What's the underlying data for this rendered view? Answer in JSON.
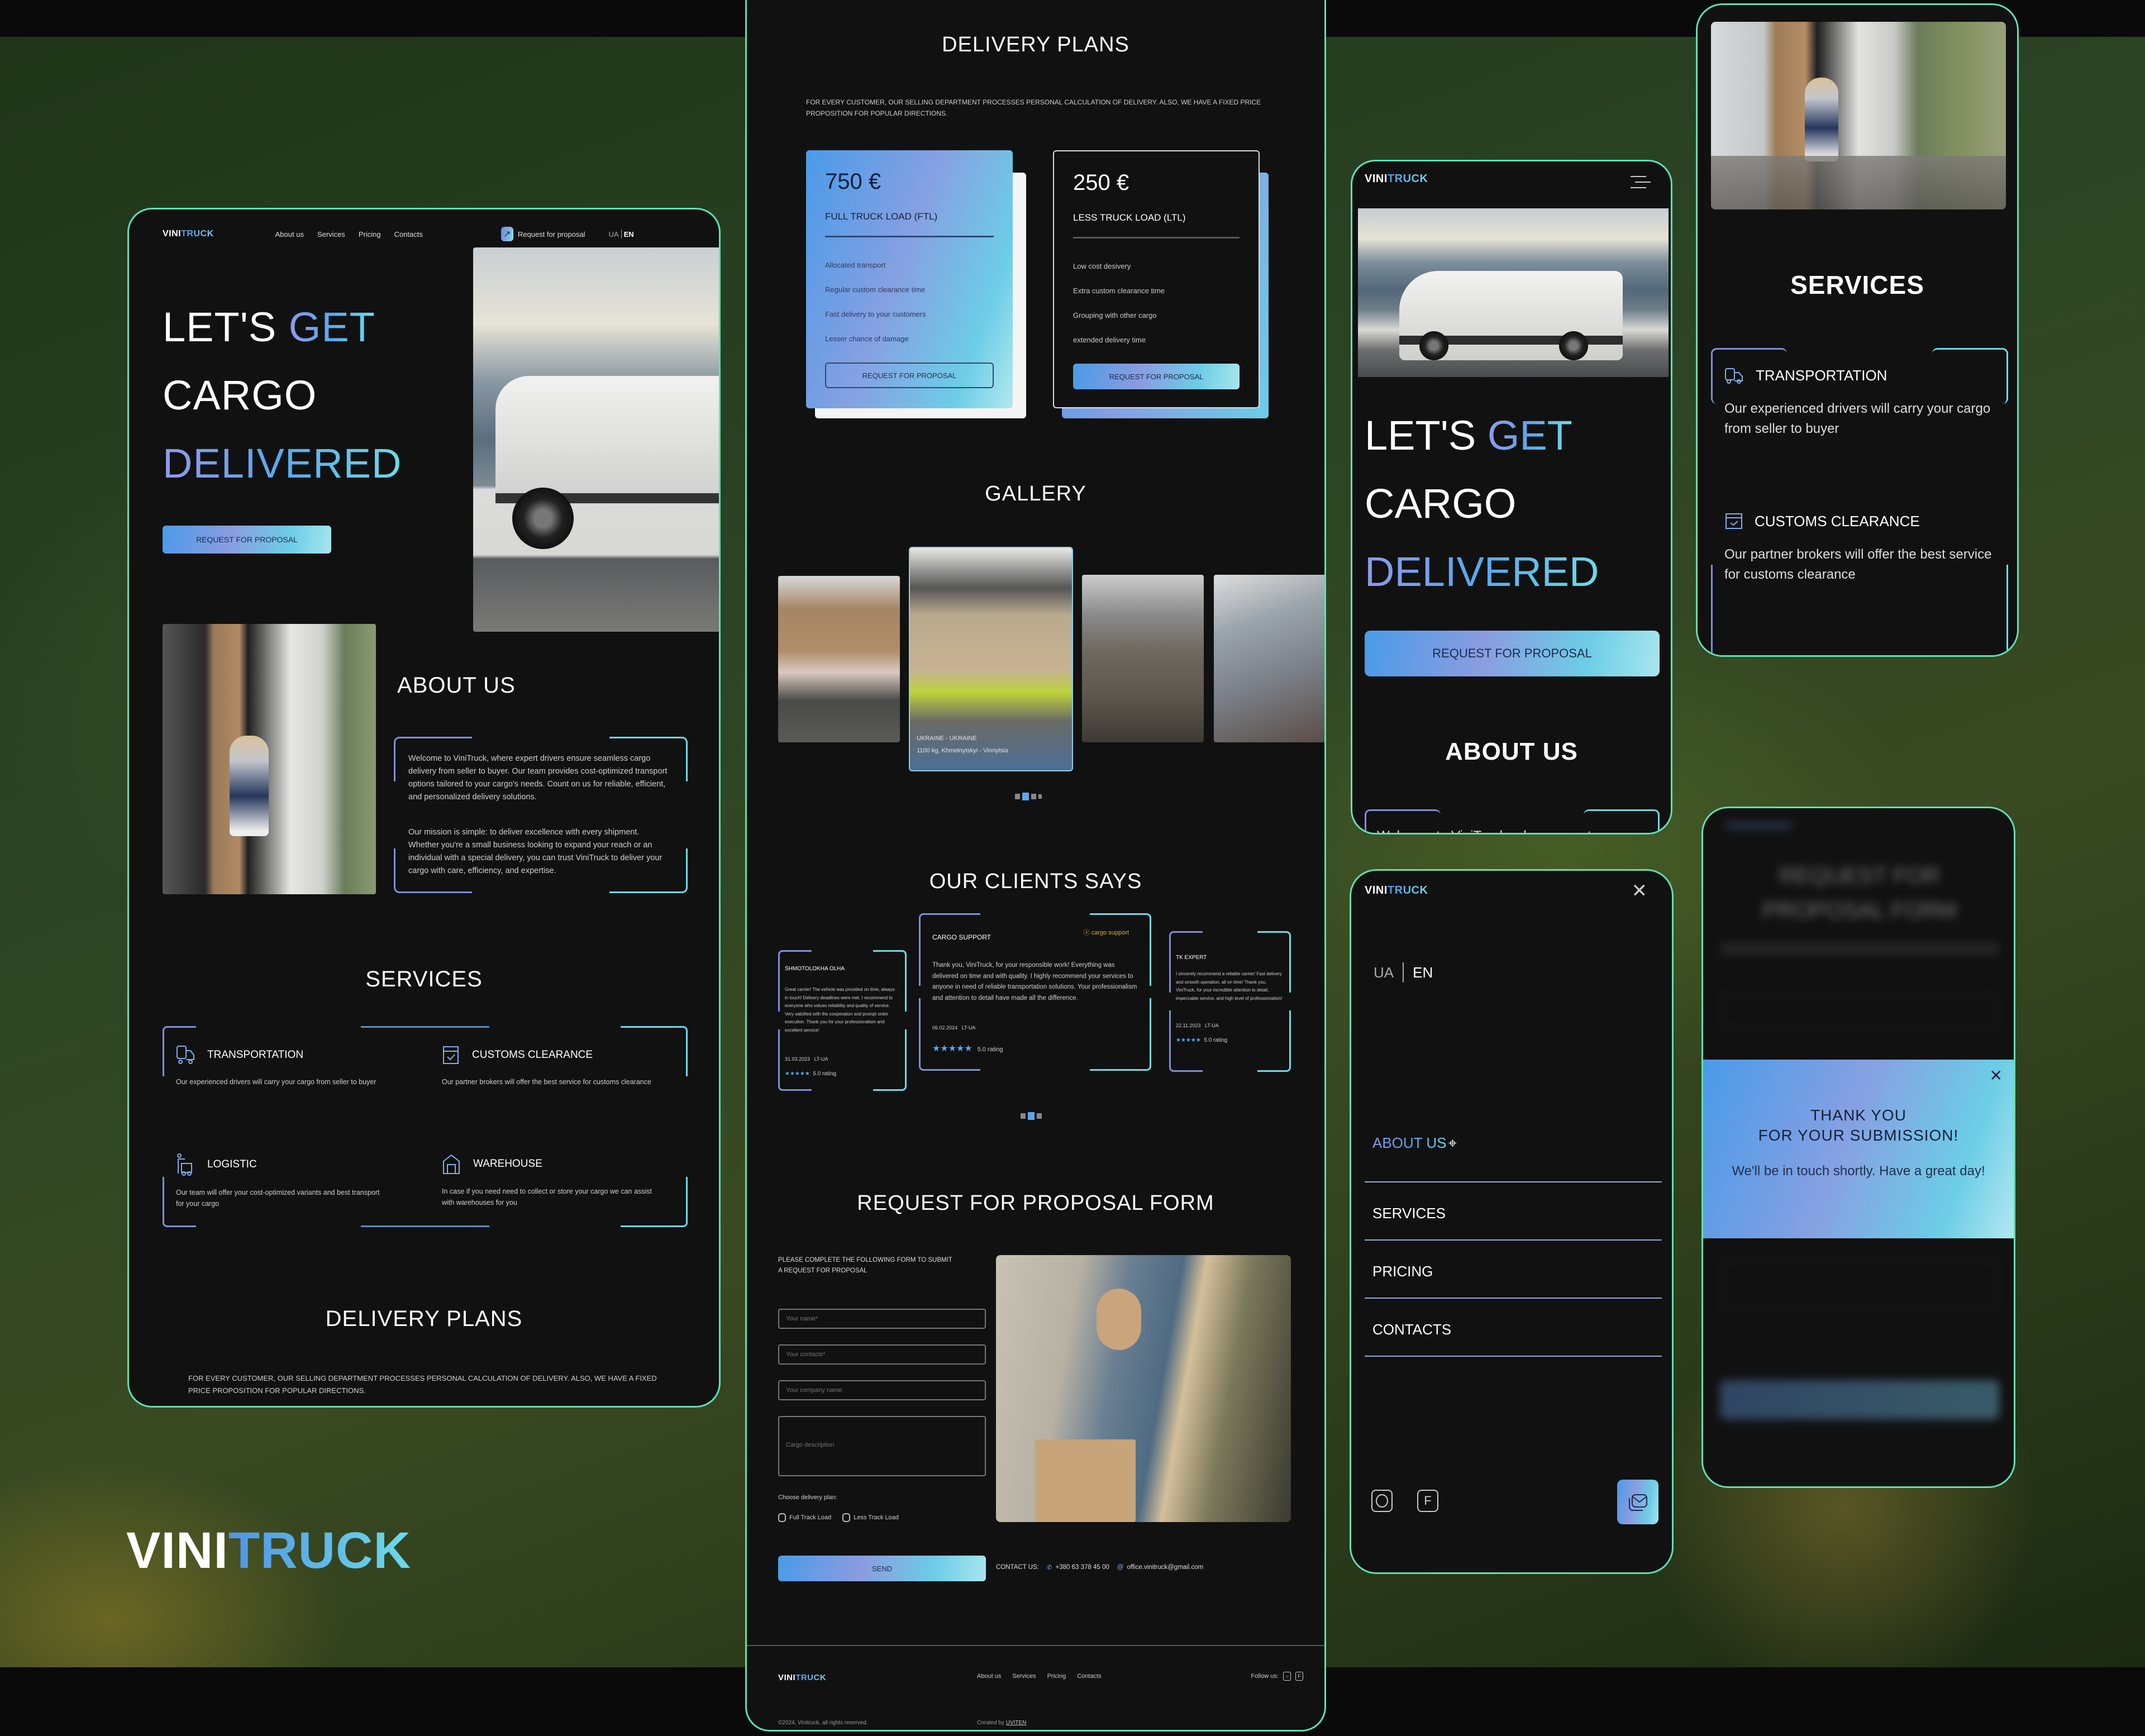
{
  "brand": {
    "logo_a": "VINI",
    "logo_b": "TRUCK"
  },
  "desktop": {
    "nav": [
      "About us",
      "Services",
      "Pricing",
      "Contacts"
    ],
    "request_link": "Request for proposal",
    "lang": {
      "ua": "UA",
      "en": "EN"
    },
    "hero": {
      "line1a": "LET'S ",
      "line1b": "GET",
      "line2": "CARGO",
      "line3": "DELIVERED",
      "button": "REQUEST FOR PROPOSAL"
    },
    "about": {
      "title": "ABOUT US",
      "p1": "Welcome to ViniTruck, where expert drivers ensure seamless cargo delivery from seller to buyer. Our team provides cost-optimized transport options tailored to your cargo's needs. Count on us for reliable, efficient, and personalized delivery solutions.",
      "p2": "Our mission is simple: to deliver excellence with every shipment. Whether you're a small business looking to expand your reach or an individual with a special delivery, you can trust ViniTruck to deliver your cargo with care, efficiency, and expertise."
    },
    "services": {
      "title": "SERVICES",
      "items": [
        {
          "icon": "truck-icon",
          "title": "TRANSPORTATION",
          "text": "Our experienced drivers will carry your cargo from seller to buyer"
        },
        {
          "icon": "customs-box-icon",
          "title": "CUSTOMS CLEARANCE",
          "text": "Our partner brokers will offer the best service for customs clearance"
        },
        {
          "icon": "logistic-icon",
          "title": "LOGISTIC",
          "text": "Our team will offer your cost-optimized variants and best transport for your cargo"
        },
        {
          "icon": "warehouse-icon",
          "title": "WAREHOUSE",
          "text": "In case if you need need to collect or store your cargo we can assist with warehouses for you"
        }
      ]
    },
    "plans": {
      "title": "DELIVERY PLANS",
      "intro": "FOR EVERY CUSTOMER, OUR SELLING DEPARTMENT PROCESSES PERSONAL CALCULATION OF DELIVERY. ALSO, WE HAVE A FIXED PRICE PROPOSITION FOR POPULAR DIRECTIONS."
    }
  },
  "tablet": {
    "plans": {
      "title": "DELIVERY PLANS",
      "intro": "FOR EVERY CUSTOMER, OUR SELLING DEPARTMENT PROCESSES PERSONAL CALCULATION OF DELIVERY. ALSO, WE HAVE A FIXED PRICE PROPOSITION FOR POPULAR DIRECTIONS.",
      "cards": [
        {
          "price": "750 €",
          "name": "FULL TRUCK LOAD (FTL)",
          "features": [
            "Allocated transport",
            "Regular custom clearance time",
            "Fast delivery to your customers",
            "Lesser chance of damage"
          ],
          "button": "REQUEST FOR PROPOSAL"
        },
        {
          "price": "250 €",
          "name": "LESS TRUCK LOAD (LTL)",
          "features": [
            "Low cost desivery",
            "Extra custom clearance time",
            "Grouping with other cargo",
            "extended delivery time"
          ],
          "button": "REQUEST FOR PROPOSAL"
        }
      ]
    },
    "gallery": {
      "title": "GALLERY",
      "active_caption_title": "UKRAINE - UKRAINE",
      "active_caption_text": "1100 kg, Khmelnytskyi - Vinnytsia",
      "page": 2,
      "pages": 4
    },
    "clients": {
      "title": "OUR CLIENTS SAYS",
      "reviews": [
        {
          "name": "SHMOTOLOKHA OLHA",
          "text": "Great carrier! The vehicle was provided on time, always in touch! Delivery deadlines were met. I recommend to everyone who values reliability and quality of service. Very satisfied with the cooperation and prompt order execution. Thank you for your professionalism and excellent service!",
          "date": "31.03.2023",
          "route": "LT-UA",
          "rating": "5.0 rating",
          "stars": 5
        },
        {
          "name": "CARGO SUPPORT",
          "logo": "cargo support",
          "text": "Thank you, ViniTruck, for your responsible work! Everything was delivered on time and with quality. I highly recommend your services to anyone in need of reliable transportation solutions. Your professionalism and attention to detail have made all the difference.",
          "date": "06.02.2024",
          "route": "LT-UA",
          "rating": "5.0 rating",
          "stars": 5
        },
        {
          "name": "TK EXPERT",
          "text": "I sincerely recommend a reliable carrier! Fast delivery and smooth operation, all on time! Thank you, ViniTruck, for your incredible attention to detail, impeccable service, and high level of professionalism!",
          "date": "22.11.2023",
          "route": "LT-UA",
          "rating": "5.0 rating",
          "stars": 5
        }
      ],
      "page": 2,
      "pages": 3
    },
    "form": {
      "title": "REQUEST FOR PROPOSAL FORM",
      "intro": "PLEASE COMPLETE THE FOLLOWING FORM TO SUBMIT A REQUEST FOR PROPOSAL",
      "name_placeholder": "Your name*",
      "contacts_placeholder": "Your contacts*",
      "company_placeholder": "Your company name",
      "cargo_placeholder": "Cargo description",
      "plan_label": "Choose delivery plan:",
      "plan_options": [
        "Full Track Load",
        "Less Track Load"
      ],
      "send": "SEND",
      "contact_label": "CONTACT US:",
      "phone": "+380 63 378 45 00",
      "email": "office.vinitruck@gmail.com"
    },
    "footer": {
      "nav": [
        "About us",
        "Services",
        "Pricing",
        "Contacts"
      ],
      "follow": "Follow us:",
      "copyright": "©2024, Vinitruck, all rights reserved.",
      "created_by": "Created by",
      "creator": "UVITEN"
    }
  },
  "mobile_home": {
    "hero": {
      "line1a": "LET'S ",
      "line1b": "GET",
      "line2": "CARGO",
      "line3": "DELIVERED",
      "button": "REQUEST FOR PROPOSAL"
    },
    "about_title": "ABOUT US",
    "about_peek": "Welcome to ViniTruck, where expert"
  },
  "mobile_menu": {
    "lang": {
      "ua": "UA",
      "en": "EN"
    },
    "items": [
      "ABOUT US",
      "SERVICES",
      "PRICING",
      "CONTACTS"
    ],
    "active_index": 0
  },
  "mobile_services": {
    "title": "SERVICES",
    "items": [
      {
        "title": "TRANSPORTATION",
        "text": "Our experienced drivers will carry your cargo from seller to buyer"
      },
      {
        "title": "CUSTOMS CLEARANCE",
        "text": "Our partner brokers will offer the best service for customs clearance"
      }
    ]
  },
  "mobile_modal": {
    "bg_title": "REQUEST FOR PROPOSAL FORM",
    "title1": "THANK YOU",
    "title2": "FOR YOUR SUBMISSION!",
    "message": "We'll be in touch shortly. Have a great day!"
  },
  "showcase_logo": {
    "a": "VINI",
    "b": "TRUCK"
  },
  "colors": {
    "frame": "#5fe0b4",
    "accent_blue": "#4f94e8",
    "accent_cyan": "#6ddbe8",
    "accent_violet": "#8f9ae8",
    "panel": "#111111"
  }
}
